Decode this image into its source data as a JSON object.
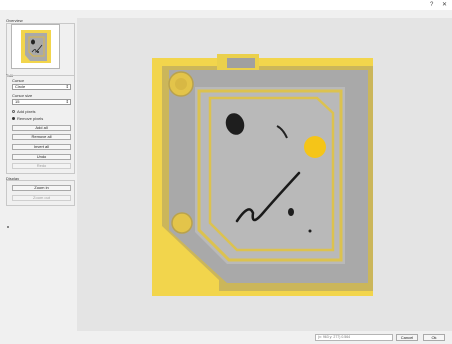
{
  "window": {
    "help_label": "?",
    "close_label": "✕"
  },
  "overview": {
    "title": "Overview"
  },
  "edit": {
    "title": "Edit",
    "cursor_label": "Cursor",
    "cursor_value": "Circle",
    "cursor_size_label": "Cursor size",
    "cursor_size_value": "15",
    "add_pixels_label": "Add pixels",
    "remove_pixels_label": "Remove pixels",
    "buttons": {
      "add_all": "Add all",
      "remove_all": "Remove all",
      "invert_all": "Invert all",
      "undo": "Undo",
      "redo": "Redo"
    }
  },
  "display": {
    "title": "Display",
    "zoom_in": "Zoom in",
    "zoom_out": "Zoom out"
  },
  "status": {
    "text": "(x: 963 y: 277) 0.564"
  },
  "actions": {
    "cancel": "Cancel",
    "ok": "Ok"
  },
  "colors": {
    "mask_yellow": "#f2d54c",
    "gray": "#a9a9a9"
  }
}
